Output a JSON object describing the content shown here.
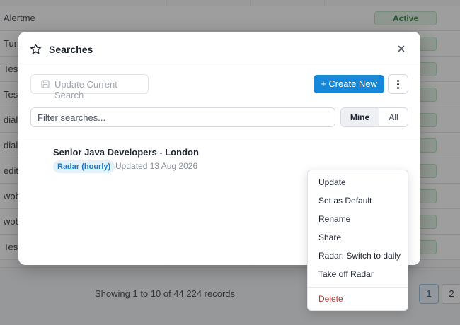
{
  "background": {
    "rows": [
      {
        "label": "Alertme",
        "badge": "Active"
      },
      {
        "label": "Turr",
        "badge": ""
      },
      {
        "label": "Test",
        "badge": ""
      },
      {
        "label": "Test",
        "badge": ""
      },
      {
        "label": "dial",
        "badge": ""
      },
      {
        "label": "dial",
        "badge": ""
      },
      {
        "label": "edit",
        "badge": ""
      },
      {
        "label": "wob",
        "badge": ""
      },
      {
        "label": "wob",
        "badge": ""
      },
      {
        "label": "Test",
        "badge": ""
      }
    ],
    "records_text": "Showing 1 to 10 of 44,224 records",
    "pages": [
      "1",
      "2"
    ]
  },
  "modal": {
    "title": "Searches",
    "update_current_label": "Update Current Search",
    "create_new_label": "+ Create New",
    "filter_placeholder": "Filter searches...",
    "filter_value": "",
    "toggle": {
      "mine": "Mine",
      "all": "All",
      "selected": "Mine"
    },
    "searches": [
      {
        "name": "Senior Java Developers - London",
        "badge": "Radar (hourly)",
        "updated": "Updated 13 Aug 2026"
      }
    ]
  },
  "context_menu": {
    "items": [
      "Update",
      "Set as Default",
      "Rename",
      "Share",
      "Radar: Switch to daily",
      "Take off Radar"
    ],
    "danger_item": "Delete"
  },
  "colors": {
    "accent": "#1687d9",
    "active_badge": "#2e7d3e",
    "danger": "#d0312d",
    "radar_badge": "#1a78c2"
  }
}
